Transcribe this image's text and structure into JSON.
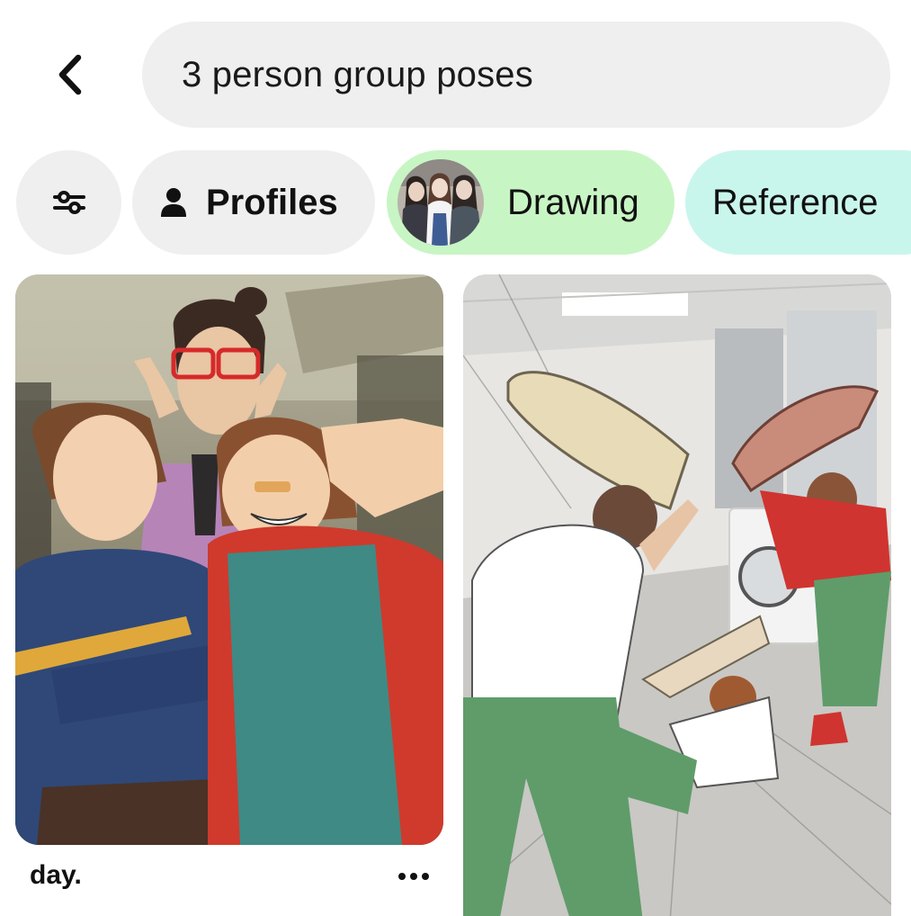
{
  "search": {
    "query": "3 person group poses"
  },
  "chips": {
    "filter_icon": "sliders-icon",
    "profiles": {
      "icon": "person-icon",
      "label": "Profiles"
    },
    "drawing": {
      "label": "Drawing",
      "color": "#c8f5c4"
    },
    "reference": {
      "label": "Reference",
      "color": "#c9f6ec"
    }
  },
  "pins": [
    {
      "title": "day.",
      "kind": "illustration of three friends posing"
    },
    {
      "title": "",
      "kind": "pillow fight photo with drawn characters"
    }
  ],
  "icons": {
    "back": "chevron-left-icon",
    "more": "more-horizontal-icon"
  }
}
